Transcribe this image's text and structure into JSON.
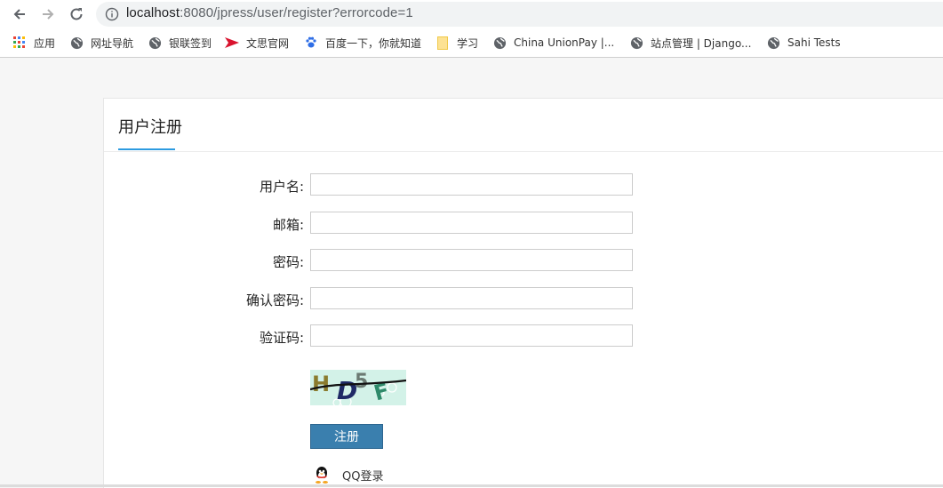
{
  "browser": {
    "url_host": "localhost",
    "url_path": ":8080/jpress/user/register?errorcode=1",
    "bookmarks": [
      {
        "label": "应用",
        "icon": "apps-grid-icon"
      },
      {
        "label": "网址导航",
        "icon": "globe-icon"
      },
      {
        "label": "银联签到",
        "icon": "globe-icon"
      },
      {
        "label": "文思官网",
        "icon": "red-flag-icon"
      },
      {
        "label": "百度一下，你就知道",
        "icon": "baidu-paw-icon"
      },
      {
        "label": "学习",
        "icon": "folder-icon"
      },
      {
        "label": "China UnionPay |...",
        "icon": "globe-icon"
      },
      {
        "label": "站点管理 | Django...",
        "icon": "globe-icon"
      },
      {
        "label": "Sahi Tests",
        "icon": "globe-icon"
      }
    ]
  },
  "page": {
    "title": "用户注册",
    "fields": {
      "username_label": "用户名:",
      "email_label": "邮箱:",
      "password_label": "密码:",
      "confirm_label": "确认密码:",
      "captcha_label": "验证码:"
    },
    "captcha_text": "HD5F",
    "register_label": "注册",
    "qq_login_label": "QQ登录"
  },
  "colors": {
    "accent": "#2d9be0",
    "button": "#3a7fae",
    "captcha_bg": "#d3f2e8"
  }
}
